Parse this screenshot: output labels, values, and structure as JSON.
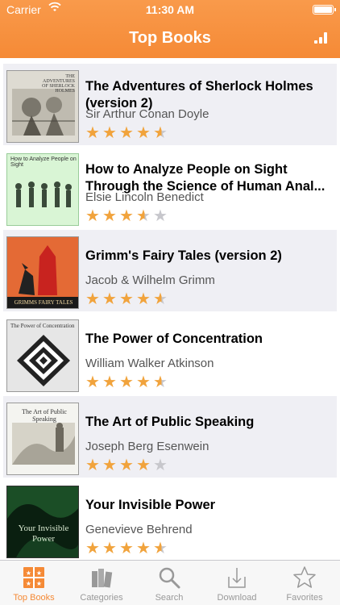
{
  "status_bar": {
    "carrier": "Carrier",
    "time": "11:30 AM"
  },
  "nav": {
    "title": "Top Books",
    "icon": "bar-chart-icon"
  },
  "colors": {
    "accent": "#f58a36",
    "star": "#f1a33c",
    "row_bg": "#efeff4"
  },
  "books": [
    {
      "title": "The Adventures of Sherlock Holmes (version 2)",
      "author": "Sir Arthur Conan Doyle",
      "rating": 4.5,
      "cover_text": "THE ADVENTURES OF SHERLOCK HOLMES"
    },
    {
      "title": "How to Analyze People on Sight Through the Science of Human Anal...",
      "author": "Elsie Lincoln Benedict",
      "rating": 3.5,
      "cover_text": "How to Analyze People on Sight"
    },
    {
      "title": "Grimm's Fairy Tales (version 2)",
      "author": "Jacob & Wilhelm Grimm",
      "rating": 4.5,
      "cover_text": "GRIMMS FAIRY TALES"
    },
    {
      "title": "The Power of Concentration",
      "author": "William Walker Atkinson",
      "rating": 4.5,
      "cover_text": "The Power of Concentration"
    },
    {
      "title": "The Art of Public Speaking",
      "author": "Joseph Berg Esenwein",
      "rating": 4,
      "cover_text": "The Art of Public Speaking"
    },
    {
      "title": "Your Invisible Power",
      "author": "Genevieve Behrend",
      "rating": 4.5,
      "cover_text": "Your Invisible Power"
    }
  ],
  "tabs": [
    {
      "label": "Top Books",
      "icon": "top-books-icon",
      "active": true
    },
    {
      "label": "Categories",
      "icon": "categories-icon",
      "active": false
    },
    {
      "label": "Search",
      "icon": "search-icon",
      "active": false
    },
    {
      "label": "Download",
      "icon": "download-icon",
      "active": false
    },
    {
      "label": "Favorites",
      "icon": "favorites-icon",
      "active": false
    }
  ]
}
